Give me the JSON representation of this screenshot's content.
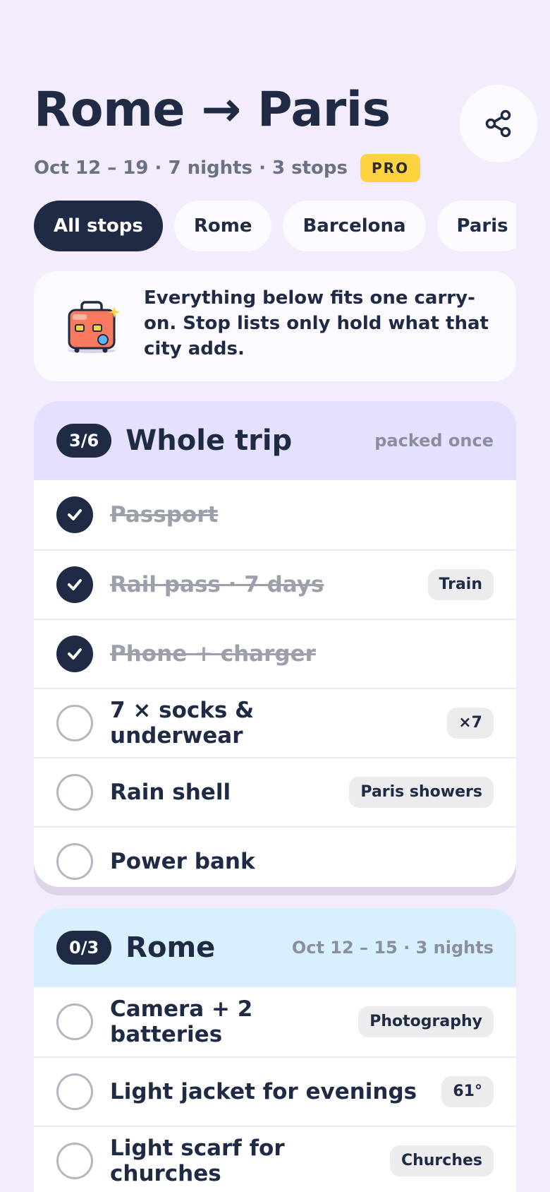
{
  "header": {
    "title": "Rome → Paris",
    "subtitle": "Oct 12 – 19 · 7 nights · 3 stops",
    "badge": "PRO",
    "share_icon": "share-icon"
  },
  "tabs": [
    {
      "label": "All stops",
      "active": true
    },
    {
      "label": "Rome",
      "active": false
    },
    {
      "label": "Barcelona",
      "active": false
    },
    {
      "label": "Paris",
      "active": false
    }
  ],
  "tip": {
    "icon": "suitcase-icon",
    "text": "Everything below fits one carry-on. Stop lists only hold what that city adds."
  },
  "sections": [
    {
      "count": "3/6",
      "title": "Whole trip",
      "meta": "packed once",
      "items": [
        {
          "label": "Passport",
          "checked": true,
          "tag": ""
        },
        {
          "label": "Rail pass · 7 days",
          "checked": true,
          "tag": "Train"
        },
        {
          "label": "Phone + charger",
          "checked": true,
          "tag": ""
        },
        {
          "label": "7 × socks & underwear",
          "checked": false,
          "tag": "×7"
        },
        {
          "label": "Rain shell",
          "checked": false,
          "tag": "Paris showers"
        },
        {
          "label": "Power bank",
          "checked": false,
          "tag": ""
        }
      ]
    },
    {
      "count": "0/3",
      "title": "Rome",
      "meta": "Oct 12 – 15 · 3 nights",
      "items": [
        {
          "label": "Camera + 2 batteries",
          "checked": false,
          "tag": "Photography"
        },
        {
          "label": "Light jacket for evenings",
          "checked": false,
          "tag": "61°"
        },
        {
          "label": "Light scarf for churches",
          "checked": false,
          "tag": "Churches"
        }
      ]
    }
  ],
  "colors": {
    "background": "#f3ecfd",
    "primary": "#1f2a44",
    "pro_badge": "#ffd23f",
    "trip_header": "#e5e0fd",
    "rome_header": "#d8effd"
  }
}
